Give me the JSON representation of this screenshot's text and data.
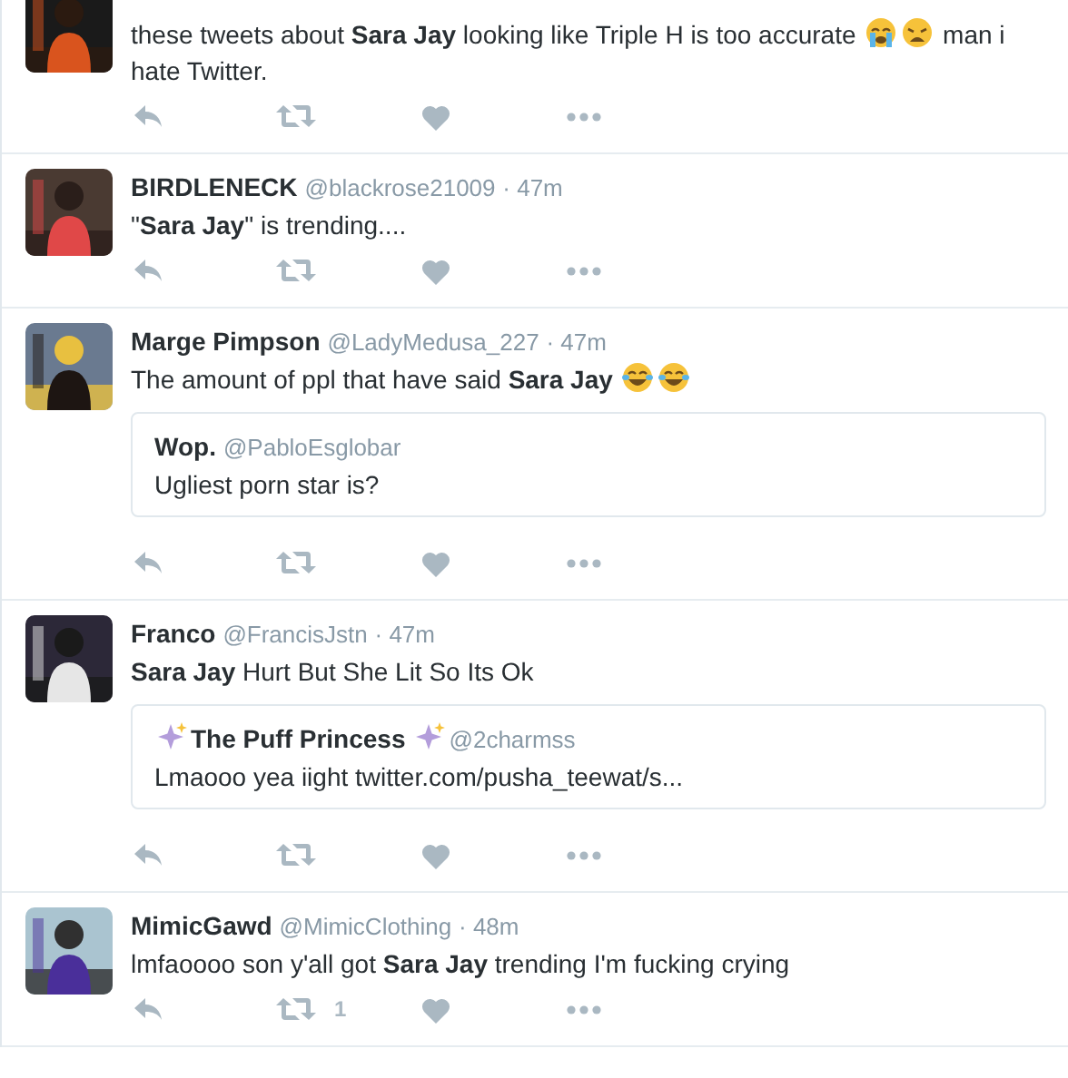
{
  "tweets": [
    {
      "body": [
        {
          "text": "these tweets about **Sara Jay** looking like Triple H is too accurate "
        },
        {
          "kind": "crying-face"
        },
        {
          "kind": "weary-face"
        },
        {
          "text": " man i"
        },
        {
          "text": "hate Twitter."
        }
      ]
    },
    {
      "name": "BIRDLENECK",
      "handle": "@blackrose21009",
      "time": "· 47m",
      "body": [
        {
          "text": "\"**Sara Jay**\" is trending...."
        }
      ]
    },
    {
      "name": "Marge Pimpson",
      "handle": "@LadyMedusa_227",
      "time": "· 47m",
      "body": [
        {
          "text": "The amount of ppl that have said **Sara Jay** "
        },
        {
          "kind": "laughing-face"
        },
        {
          "kind": "laughing-face"
        }
      ],
      "quote": {
        "name": [
          {
            "text": "Wop."
          }
        ],
        "handle": "@PabloEsglobar",
        "text": "Ugliest porn star is?"
      }
    },
    {
      "name": "Franco",
      "handle": "@FrancisJstn",
      "time": "· 47m",
      "body": [
        {
          "text": "**Sara Jay** Hurt But She Lit So Its Ok"
        }
      ],
      "quote": {
        "name": [
          {
            "kind": "sparkles"
          },
          {
            "text": "The Puff Princess"
          },
          {
            "kind": "sparkles"
          }
        ],
        "handle": "@2charmss",
        "text": "Lmaooo yea iight twitter.com/pusha_teewat/s..."
      }
    },
    {
      "name": "MimicGawd",
      "handle": "@MimicClothing",
      "time": "· 48m",
      "body": [
        {
          "text": "lmfaoooo son y'all got **Sara Jay** trending I'm fucking crying"
        }
      ],
      "retweets": "1"
    }
  ]
}
